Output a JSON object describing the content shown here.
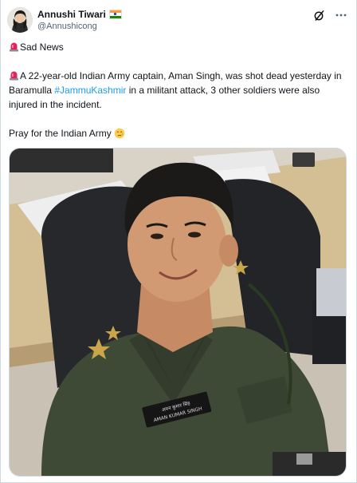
{
  "author": {
    "display_name": "Annushi Tiwari",
    "handle": "@Annushicong",
    "flag_icon": "india-flag-icon"
  },
  "actions": {
    "grok_icon": "grok-icon",
    "more_icon": "more-options-icon"
  },
  "tweet": {
    "line1_emoji": "siren-emoji",
    "line1_text": "Sad News",
    "line2_emoji": "siren-emoji",
    "line2_text_before": "A 22-year-old Indian Army captain, Aman Singh, was shot dead yesterday in Baramulla ",
    "hashtag": "#JammuKashmir",
    "line2_text_after": " in a militant attack, 3 other soldiers were also injured in the incident.",
    "line3_text": "Pray for the Indian Army",
    "line3_emoji": "crying-face-emoji"
  },
  "media": {
    "name_tag_line1": "अमन कुमार सिंह",
    "name_tag_line2": "AMAN KUMAR SINGH"
  },
  "colors": {
    "text": "#0f1419",
    "secondary": "#536471",
    "link": "#1d9bf0",
    "border": "#cfd9de",
    "uniform": "#3f4a36",
    "siren_red": "#e0245e"
  }
}
